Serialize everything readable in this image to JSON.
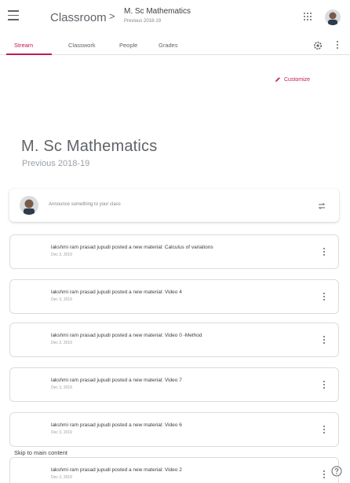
{
  "header": {
    "app_title": "Classroom",
    "separator": ">",
    "class_name": "M. Sc Mathematics",
    "class_section": "Previous 2018-19",
    "icons": [
      "menu-icon",
      "apps-icon",
      "account-avatar"
    ]
  },
  "tabs": [
    {
      "label": "Stream",
      "active": true
    },
    {
      "label": "Classwork",
      "active": false
    },
    {
      "label": "People",
      "active": false
    },
    {
      "label": "Grades",
      "active": false
    }
  ],
  "banner": {
    "customize_label": "Customize",
    "title": "M. Sc Mathematics",
    "subtitle": "Previous 2018-19"
  },
  "announce": {
    "placeholder": "Announce something to your class"
  },
  "posts": [
    {
      "text": "lakshmi ram prasad jupudi posted a new material: Calculus of variations",
      "date": "Dec 3, 2019"
    },
    {
      "text": "lakshmi ram prasad jupudi posted a new material: Video 4",
      "date": "Dec 3, 2019"
    },
    {
      "text": "lakshmi ram prasad jupudi posted a new material: Video 0 -Method",
      "date": "Dec 3, 2019"
    },
    {
      "text": "lakshmi ram prasad jupudi posted a new material: Video 7",
      "date": "Dec 3, 2019"
    },
    {
      "text": "lakshmi ram prasad jupudi posted a new material: Video 6",
      "date": "Dec 3, 2019"
    },
    {
      "text": "lakshmi ram prasad jupudi posted a new material: Video 2",
      "date": "Dec 3, 2019"
    }
  ],
  "skip_link": "Skip to main content",
  "colors": {
    "accent": "#c2185b",
    "text": "#3c4043",
    "muted": "#80868b"
  }
}
